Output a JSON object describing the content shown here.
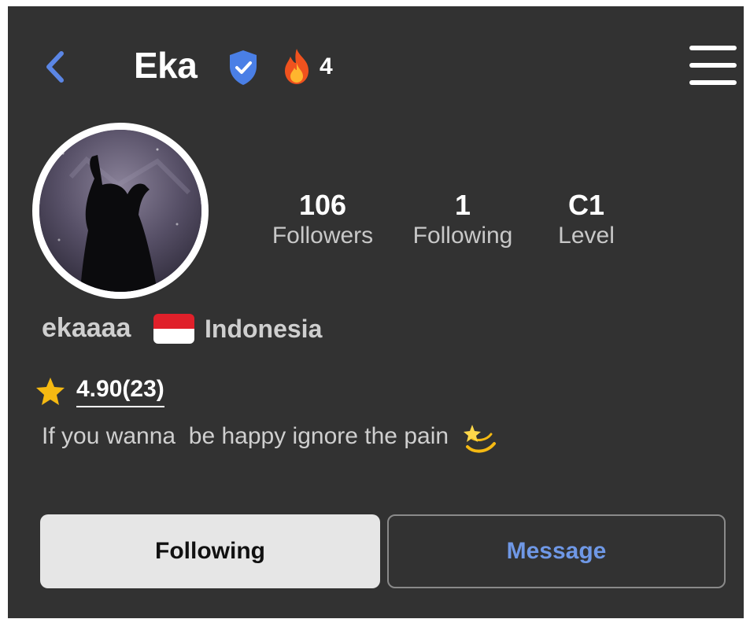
{
  "header": {
    "title": "Eka",
    "streak_count": "4",
    "icons": {
      "back": "chevron-left-icon",
      "verified": "verified-shield-icon",
      "streak": "flame-icon",
      "menu": "hamburger-menu-icon"
    }
  },
  "profile": {
    "avatar": "avatar",
    "stats": [
      {
        "value": "106",
        "label": "Followers"
      },
      {
        "value": "1",
        "label": "Following"
      },
      {
        "value": "C1",
        "label": "Level"
      }
    ],
    "username": "ekaaaa",
    "country": "Indonesia",
    "rating": "4.90(23)",
    "bio": "If you wanna  be happy ignore the pain"
  },
  "actions": {
    "following_label": "Following",
    "message_label": "Message"
  },
  "colors": {
    "background": "#323232",
    "accent_blue": "#6f98e6",
    "verified_blue": "#4a7fe6",
    "star_yellow": "#f5b912",
    "flag_red": "#e0202a"
  }
}
